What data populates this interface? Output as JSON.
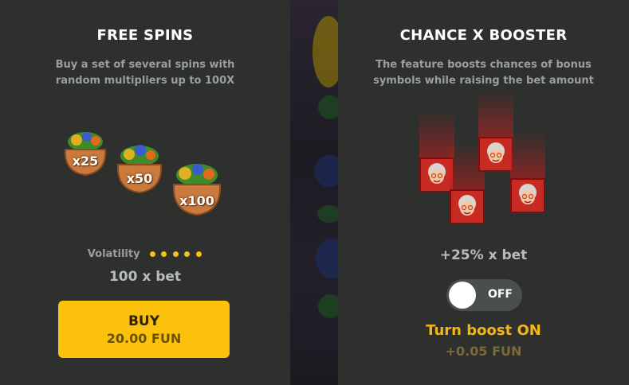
{
  "free_spins": {
    "title": "FREE SPINS",
    "description_line1": "Buy a set of several spins with",
    "description_line2": "random multipliers up to 100X",
    "bags": [
      "x25",
      "x50",
      "x100"
    ],
    "volatility_label": "Volatility",
    "volatility_level": 5,
    "price_multiplier": "100 x bet",
    "buy_label": "BUY",
    "buy_price": "20.00 FUN"
  },
  "chance_booster": {
    "title": "CHANCE X BOOSTER",
    "description_line1": "The feature boosts chances of bonus",
    "description_line2": "symbols while raising the bet amount",
    "bet_increase": "+25% x bet",
    "toggle_state": "OFF",
    "turn_boost_label": "Turn boost ON",
    "boost_cost": "+0.05 FUN"
  },
  "colors": {
    "accent_yellow": "#fbc10b",
    "panel_bg": "#2e302e",
    "granny_tile": "#c62a22"
  }
}
